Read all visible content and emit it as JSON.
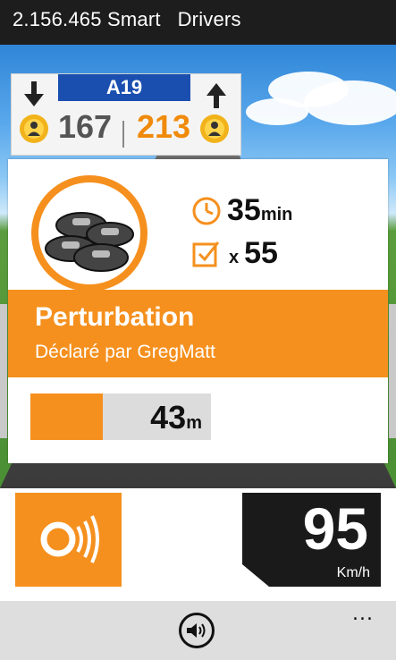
{
  "header": {
    "title": "2.156.465 Smart   Drivers"
  },
  "sign": {
    "road": "A19",
    "users_down": "167",
    "users_up": "213",
    "left_arrow_icon": "arrow-down-icon",
    "right_arrow_icon": "arrow-up-icon",
    "badge_icon": "user-badge-icon"
  },
  "event": {
    "icon": "traffic-jam-icon",
    "duration_value": "35",
    "duration_unit": "min",
    "confirm_prefix": "x",
    "confirm_count": "55",
    "title": "Perturbation",
    "reported_by": "Déclaré par GregMatt",
    "distance_value": "43",
    "distance_unit": "m",
    "distance_progress_percent": 40
  },
  "controls": {
    "report_button_icon": "signal-broadcast-icon",
    "speed_value": "95",
    "speed_unit": "Km/h"
  },
  "appbar": {
    "sound_icon": "speaker-icon",
    "more_label": "..."
  },
  "colors": {
    "accent": "#f5901e",
    "road_sign_blue": "#1a4fb0",
    "dark": "#1a1a1a",
    "appbar": "#dedede"
  }
}
